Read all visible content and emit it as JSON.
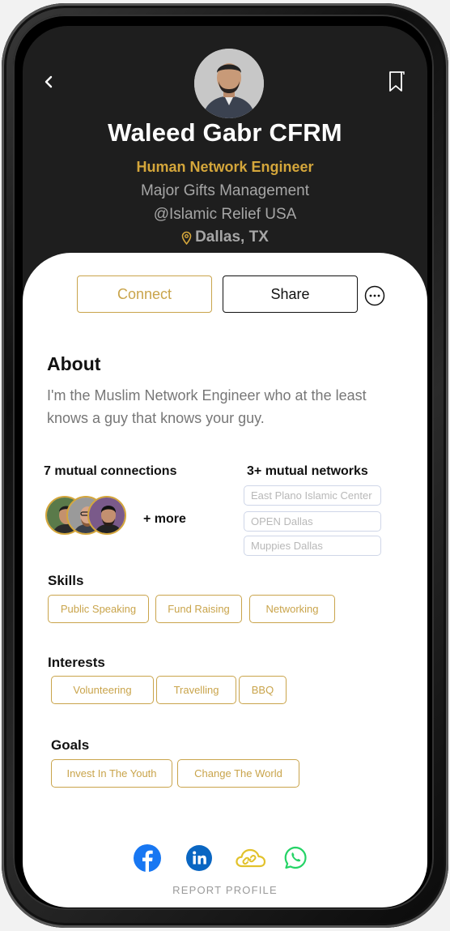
{
  "profile": {
    "name": "Waleed Gabr CFRM",
    "title": "Human Network Engineer",
    "org_line1": "Major Gifts Management",
    "org_line2": "@Islamic Relief USA",
    "location": "Dallas, TX"
  },
  "actions": {
    "connect_label": "Connect",
    "share_label": "Share"
  },
  "about": {
    "heading": "About",
    "text": "I'm the Muslim Network Engineer who at the least knows a guy that knows your guy."
  },
  "mutual": {
    "connections_label": "7 mutual connections",
    "networks_label": "3+ mutual networks",
    "more_label": "+ more",
    "networks": [
      "East Plano Islamic Center",
      "OPEN Dallas",
      "Muppies Dallas"
    ]
  },
  "skills": {
    "heading": "Skills",
    "items": [
      "Public Speaking",
      "Fund Raising",
      "Networking"
    ]
  },
  "interests": {
    "heading": "Interests",
    "items": [
      "Volunteering",
      "Travelling",
      "BBQ"
    ]
  },
  "goals": {
    "heading": "Goals",
    "items": [
      "Invest In The Youth",
      "Change The World"
    ]
  },
  "footer": {
    "report_label": "REPORT PROFILE",
    "social_icons": [
      "facebook-icon",
      "linkedin-icon",
      "link-cloud-icon",
      "whatsapp-icon"
    ]
  },
  "colors": {
    "accent_gold": "#d4a63b",
    "header_bg": "#1e1e1e",
    "facebook": "#1877f2",
    "linkedin": "#0a66c2",
    "whatsapp": "#25d366"
  }
}
